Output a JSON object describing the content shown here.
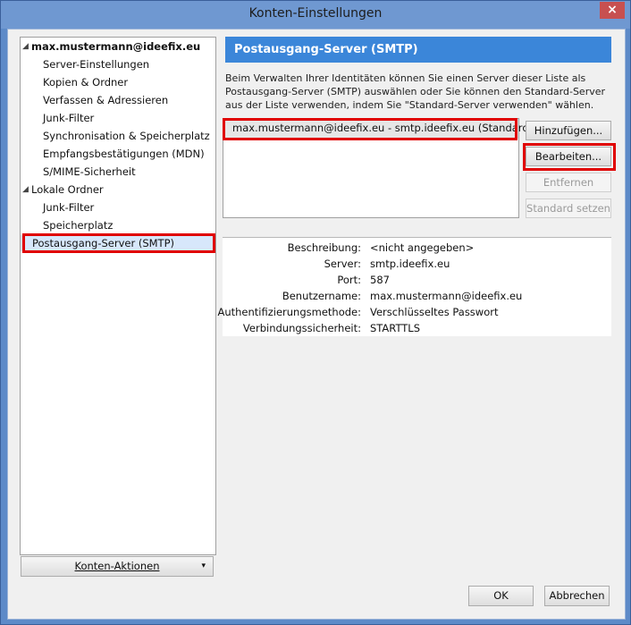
{
  "window": {
    "title": "Konten-Einstellungen",
    "close_glyph": "×"
  },
  "tree": {
    "account": "max.mustermann@ideefix.eu",
    "account_items": [
      "Server-Einstellungen",
      "Kopien & Ordner",
      "Verfassen & Adressieren",
      "Junk-Filter",
      "Synchronisation & Speicherplatz",
      "Empfangsbestätigungen (MDN)",
      "S/MIME-Sicherheit"
    ],
    "local": "Lokale Ordner",
    "local_items": [
      "Junk-Filter",
      "Speicherplatz"
    ],
    "smtp": "Postausgang-Server (SMTP)"
  },
  "accounts_button": {
    "label": "Konten-Aktionen",
    "arrow": "▾"
  },
  "panel": {
    "title": "Postausgang-Server (SMTP)",
    "description": "Beim Verwalten Ihrer Identitäten können Sie einen Server dieser Liste als Postausgang-Server (SMTP) auswählen oder Sie können den Standard-Server aus der Liste verwenden, indem Sie \"Standard-Server verwenden\" wählen.",
    "server_list": [
      "max.mustermann@ideefix.eu - smtp.ideefix.eu (Standard)"
    ],
    "buttons": {
      "add": "Hinzufügen...",
      "edit": "Bearbeiten...",
      "remove": "Entfernen",
      "set_default": "Standard setzen"
    },
    "details": [
      {
        "label": "Beschreibung:",
        "value": "<nicht angegeben>"
      },
      {
        "label": "Server:",
        "value": "smtp.ideefix.eu"
      },
      {
        "label": "Port:",
        "value": "587"
      },
      {
        "label": "Benutzername:",
        "value": "max.mustermann@ideefix.eu"
      },
      {
        "label": "Authentifizierungsmethode:",
        "value": "Verschlüsseltes Passwort"
      },
      {
        "label": "Verbindungssicherheit:",
        "value": "STARTTLS"
      }
    ]
  },
  "footer": {
    "ok": "OK",
    "cancel": "Abbrechen"
  },
  "colors": {
    "highlight": "#e00000",
    "header": "#3b86d9",
    "titlebar": "#6f98d1"
  }
}
